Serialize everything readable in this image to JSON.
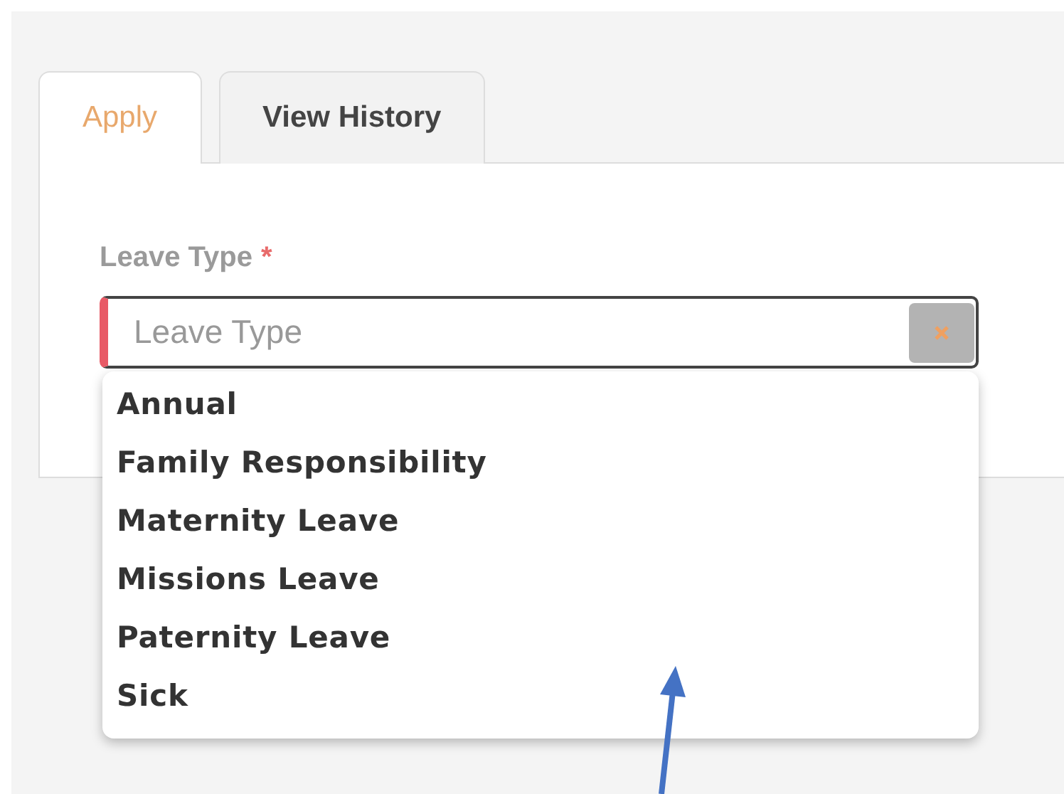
{
  "tabs": [
    {
      "label": "Apply",
      "selected": true
    },
    {
      "label": "View History",
      "selected": false
    }
  ],
  "leave_type": {
    "label": "Leave Type",
    "required_mark": "*",
    "placeholder": "Leave Type",
    "required": true,
    "expanded": true,
    "options": [
      "Annual",
      "Family Responsibility",
      "Maternity Leave",
      "Missions Leave",
      "Paternity Leave",
      "Sick"
    ]
  }
}
